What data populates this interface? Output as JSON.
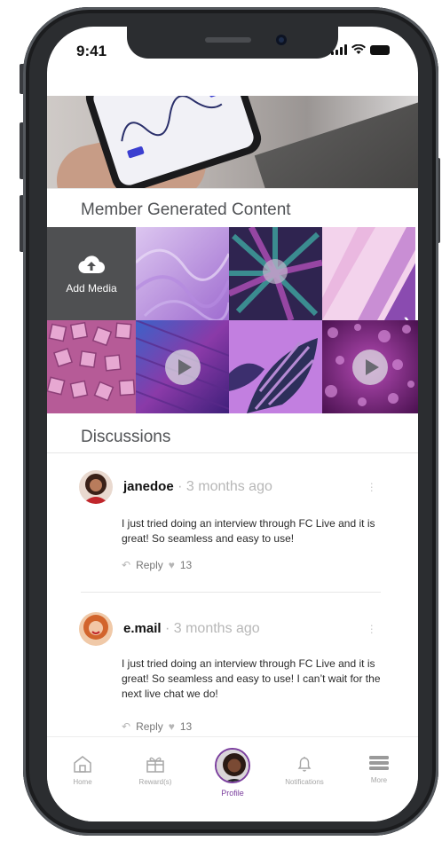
{
  "status_bar": {
    "time": "9:41"
  },
  "sections": {
    "member_content_title": "Member Generated Content",
    "discussions_title": "Discussions"
  },
  "media": {
    "add_label": "Add Media",
    "tiles": [
      {
        "name": "purple-silk",
        "type": "image",
        "colors": [
          "#d2b8ea",
          "#9f6cd0"
        ]
      },
      {
        "name": "tropical-leaves",
        "type": "image",
        "colors": [
          "#3a2a5c",
          "#9c3aa8"
        ]
      },
      {
        "name": "pink-stripes",
        "type": "image",
        "colors": [
          "#f0c6e6",
          "#b46ec7"
        ]
      },
      {
        "name": "pink-blocks",
        "type": "image",
        "colors": [
          "#c76ea8",
          "#8d3f78"
        ]
      },
      {
        "name": "building",
        "type": "video",
        "colors": [
          "#8a3aa8",
          "#3e1f7a"
        ]
      },
      {
        "name": "monstera-leaf",
        "type": "image",
        "colors": [
          "#b56bd6",
          "#3a2e62"
        ]
      },
      {
        "name": "bubbles",
        "type": "video",
        "colors": [
          "#9a3d9c",
          "#4a1150"
        ]
      }
    ]
  },
  "comments": [
    {
      "user": "janedoe",
      "time": " · 3 months ago",
      "text": "I just tried doing an interview through FC Live and it is great! So seamless and easy to use!",
      "reply_label": "Reply",
      "likes": "13"
    },
    {
      "user": "e.mail",
      "time": " · 3 months ago",
      "text": "I just tried doing an interview through FC Live and it is great! So seamless and easy to use! I can’t wait for the next live chat we do!",
      "reply_label": "Reply",
      "likes": "13"
    }
  ],
  "nav": {
    "home": "Home",
    "rewards": "Reward(s)",
    "profile": "Profile",
    "notifications": "Notifications",
    "more": "More"
  },
  "colors": {
    "accent": "#7b3f9e",
    "muted": "#a6a6a6"
  }
}
